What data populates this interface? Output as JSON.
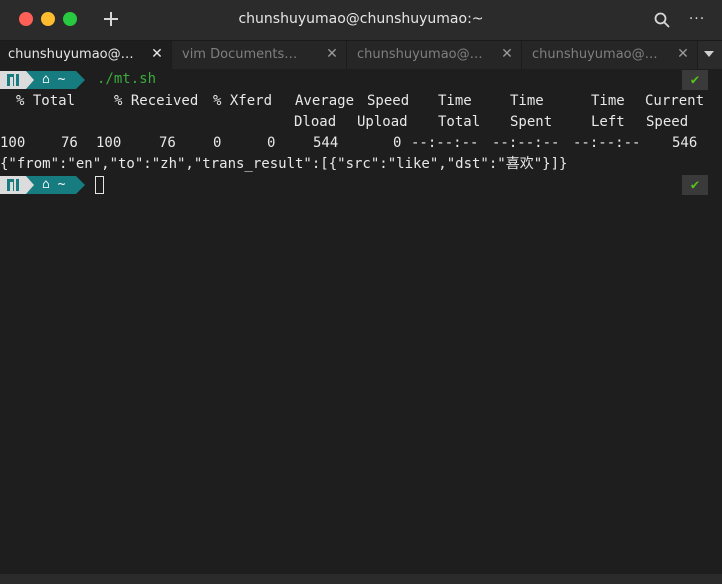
{
  "window": {
    "title": "chunshuyumao@chunshuyumao:~"
  },
  "tabs": [
    {
      "label": "chunshuyumao@…",
      "active": true
    },
    {
      "label": "vim Documents…",
      "active": false
    },
    {
      "label": "chunshuyumao@…",
      "active": false
    },
    {
      "label": "chunshuyumao@…",
      "active": false
    }
  ],
  "icons": {
    "close": "✕",
    "more": "···",
    "check": "✔",
    "home_text": "⌂ ~"
  },
  "terminal": {
    "command": "./mt.sh",
    "header1": [
      "% Total",
      "% Received",
      "% Xferd",
      "Average",
      "Speed",
      "Time",
      "Time",
      "Time",
      "Current"
    ],
    "header2": [
      "Dload",
      "Upload",
      "Total",
      "Spent",
      "Left",
      "Speed"
    ],
    "stats": [
      "100",
      "76",
      "100",
      "76",
      "0",
      "0",
      "544",
      "0",
      "--:--:--",
      "--:--:--",
      "--:--:--",
      "546"
    ],
    "json_output": "{\"from\":\"en\",\"to\":\"zh\",\"trans_result\":[{\"src\":\"like\",\"dst\":\"喜欢\"}]}"
  },
  "colors": {
    "background": "#1e1e1e",
    "titlebar": "#2b2b2b",
    "prompt_home": "#167c80",
    "command": "#3dab3d",
    "check": "#52c41a"
  }
}
